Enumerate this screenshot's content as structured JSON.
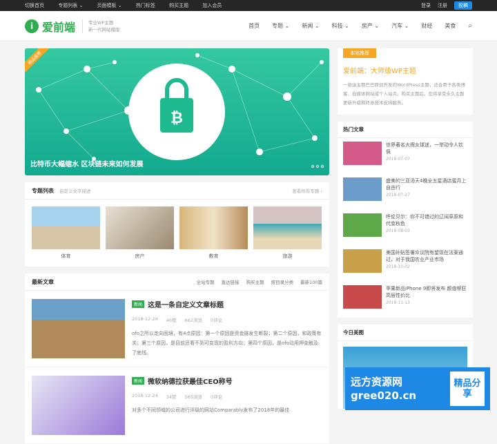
{
  "topbar": {
    "left": [
      "切换首页",
      "专题列表 ⌄",
      "页面模板 ⌄",
      "热门标签",
      "购买主题",
      "加入会员"
    ],
    "login": "登录",
    "register": "注册",
    "contribute": "投稿"
  },
  "header": {
    "logo_mark": "i",
    "logo_text": "爱前端",
    "slogan1": "专业WP主题",
    "slogan2": "新一代网站模版"
  },
  "nav": [
    "首页",
    "专题 ⌄",
    "新闻 ⌄",
    "科技 ⌄",
    "房产 ⌄",
    "汽车 ⌄",
    "财经",
    "美食"
  ],
  "hero": {
    "badge": "精品推荐",
    "caption": "比特币大幅缩水 区块链未来如何发展"
  },
  "topics": {
    "title": "专题列表",
    "sub": "自定义文字描述",
    "more": "查看所有专题 ›",
    "items": [
      "体育",
      "房产",
      "教育",
      "旅游"
    ]
  },
  "latest": {
    "title": "最新文章",
    "tabs": [
      "全站专题",
      "直达链接",
      "购买主题",
      "按目录分类",
      "最新100篇"
    ],
    "posts": [
      {
        "tag": "新闻",
        "title": "这是一条自定义文章标题",
        "date": "2018-12-24",
        "likes": "46赞",
        "views": "662浏览",
        "comments": "0评论",
        "excerpt": "ofo之所以走向困境，有4点原因：第一个原因是资金链发生断裂；第二个原因，和政策有关；第三个原因，是目前还看不到可变现的盈利方向；第四个原因，是ofo动用押金触及了底线。"
      },
      {
        "tag": "新闻",
        "title": "微软纳德拉获最佳CEO称号",
        "date": "2018-12-24",
        "likes": "34赞",
        "views": "565浏览",
        "comments": "0评论",
        "excerpt": "对多个不同领域的公司进行评级的网站Comparably发布了2018年的最佳"
      }
    ]
  },
  "side": {
    "rec_label": "本站推荐",
    "rec_title": "爱前端：大师级WP主题",
    "rec_desc": "一款由主题巴巴原创开发的WordPress主题，适合用于各类博客、自媒体网站或个人站点。购买主题后，您将享受永久主题更新升级和终身技术支持服务。",
    "hot_title": "热门文章",
    "hot": [
      {
        "t": "世界著名大牌女球迷，一举动令人钦佩",
        "d": "2018-07-07"
      },
      {
        "t": "盛美的三亚汤天4晚全五星酒店蜜月上自由行",
        "d": "2018-07-27"
      },
      {
        "t": "呼伦贝尔：你不可错过的辽阔草原和代变秋色",
        "d": "2018-08-03"
      },
      {
        "t": "美国补贴签署众议院有望现在法案通过，对于我国农业产业市场",
        "d": "2018-10-02"
      },
      {
        "t": "苹果新品iPhone 9即将发布 颜值够狂高层性价比",
        "d": "2018-11-13"
      }
    ],
    "today_title": "今日美图"
  },
  "watermark": {
    "line1": "远方资源网",
    "line2": "gree020.cn",
    "badge": "精品分享"
  }
}
